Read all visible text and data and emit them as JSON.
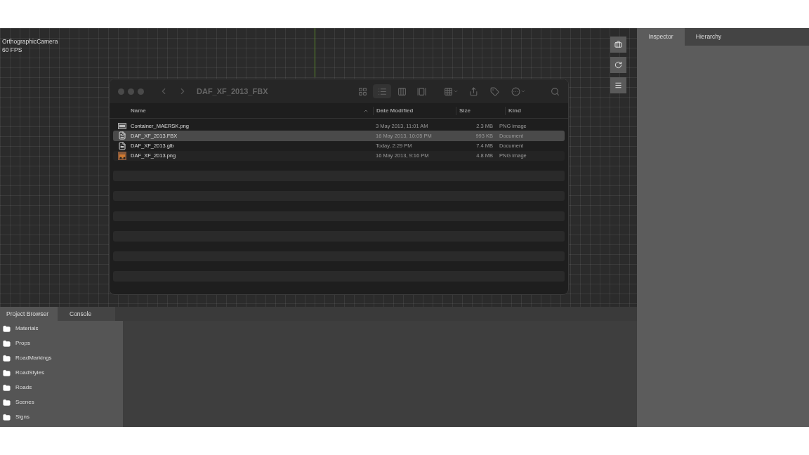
{
  "viewport": {
    "camera": "OrthographicCamera",
    "fps": "60 FPS"
  },
  "viewport_tools": [
    {
      "kind": "briefcase"
    },
    {
      "kind": "refresh"
    },
    {
      "kind": "menu"
    }
  ],
  "finder": {
    "title": "DAF_XF_2013_FBX",
    "views": [
      {
        "kind": "icons",
        "selected": false
      },
      {
        "kind": "list",
        "selected": true
      },
      {
        "kind": "columns",
        "selected": false
      },
      {
        "kind": "gallery",
        "selected": false
      }
    ],
    "columns": [
      "Name",
      "Date Modified",
      "Size",
      "Kind"
    ],
    "files": [
      {
        "kind": "image-thumb",
        "name": "Container_MAERSK.png",
        "date": "3 May 2013, 11:01 AM",
        "size": "2.3 MB",
        "type": "PNG image",
        "selected": false
      },
      {
        "kind": "document",
        "name": "DAF_XF_2013.FBX",
        "date": "16 May 2013, 10:05 PM",
        "size": "993 KB",
        "type": "Document",
        "selected": true
      },
      {
        "kind": "document",
        "name": "DAF_XF_2013.glb",
        "date": "Today, 2:29 PM",
        "size": "7.4 MB",
        "type": "Document",
        "selected": false
      },
      {
        "kind": "image-photo",
        "name": "DAF_XF_2013.png",
        "date": "16 May 2013, 9:16 PM",
        "size": "4.8 MB",
        "type": "PNG image",
        "selected": false
      }
    ]
  },
  "right_tabs": [
    {
      "label": "Inspector",
      "selected": true
    },
    {
      "label": "Hierarchy",
      "selected": false
    }
  ],
  "bottom_tabs": [
    {
      "label": "Project Browser",
      "selected": true
    },
    {
      "label": "Console",
      "selected": false
    }
  ],
  "folders": [
    "Materials",
    "Props",
    "RoadMarkings",
    "RoadStyles",
    "Roads",
    "Scenes",
    "Signs"
  ]
}
